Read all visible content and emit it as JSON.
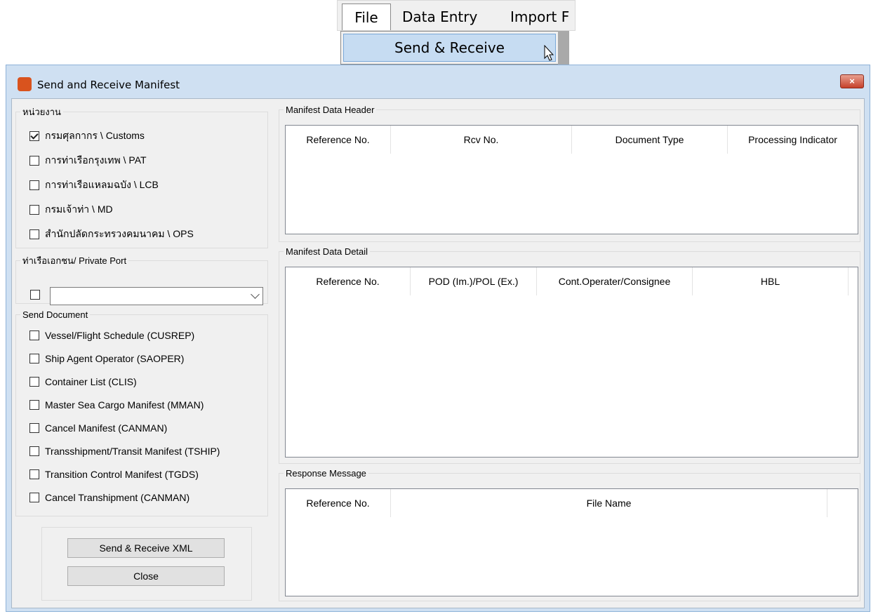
{
  "menubar": {
    "items": [
      "File",
      "Data Entry",
      "Import F"
    ],
    "dropdown_item": "Send & Receive"
  },
  "window": {
    "title": "Send and Receive Manifest",
    "close_glyph": "×"
  },
  "agency": {
    "legend": "หน่วยงาน",
    "items": [
      {
        "label": "กรมศุลกากร \\ Customs",
        "checked": true
      },
      {
        "label": "การท่าเรือกรุงเทพ \\ PAT",
        "checked": false
      },
      {
        "label": "การท่าเรือแหลมฉบัง \\ LCB",
        "checked": false
      },
      {
        "label": "กรมเจ้าท่า \\ MD",
        "checked": false
      },
      {
        "label": "สำนักปลัดกระทรวงคมนาคม \\ OPS",
        "checked": false
      }
    ]
  },
  "private_port": {
    "legend": "ท่าเรือเอกชน/ Private Port",
    "checked": false,
    "value": ""
  },
  "send_document": {
    "legend": "Send Document",
    "items": [
      {
        "label": "Vessel/Flight Schedule (CUSREP)",
        "checked": false
      },
      {
        "label": "Ship Agent Operator (SAOPER)",
        "checked": false
      },
      {
        "label": "Container List (CLIS)",
        "checked": false
      },
      {
        "label": "Master Sea Cargo Manifest (MMAN)",
        "checked": false
      },
      {
        "label": "Cancel Manifest (CANMAN)",
        "checked": false
      },
      {
        "label": "Transshipment/Transit Manifest (TSHIP)",
        "checked": false
      },
      {
        "label": "Transition Control Manifest (TGDS)",
        "checked": false
      },
      {
        "label": "Cancel Transhipment (CANMAN)",
        "checked": false
      }
    ]
  },
  "buttons": {
    "send_receive": "Send & Receive XML",
    "close": "Close"
  },
  "manifest_header": {
    "legend": "Manifest Data Header",
    "columns": [
      "Reference No.",
      "Rcv No.",
      "Document Type",
      "Processing Indicator"
    ],
    "rows": []
  },
  "manifest_detail": {
    "legend": "Manifest Data Detail",
    "columns": [
      "Reference No.",
      "POD (Im.)/POL (Ex.)",
      "Cont.Operater/Consignee",
      "HBL"
    ],
    "rows": []
  },
  "response": {
    "legend": "Response Message",
    "columns": [
      "Reference No.",
      "File Name"
    ],
    "rows": []
  }
}
